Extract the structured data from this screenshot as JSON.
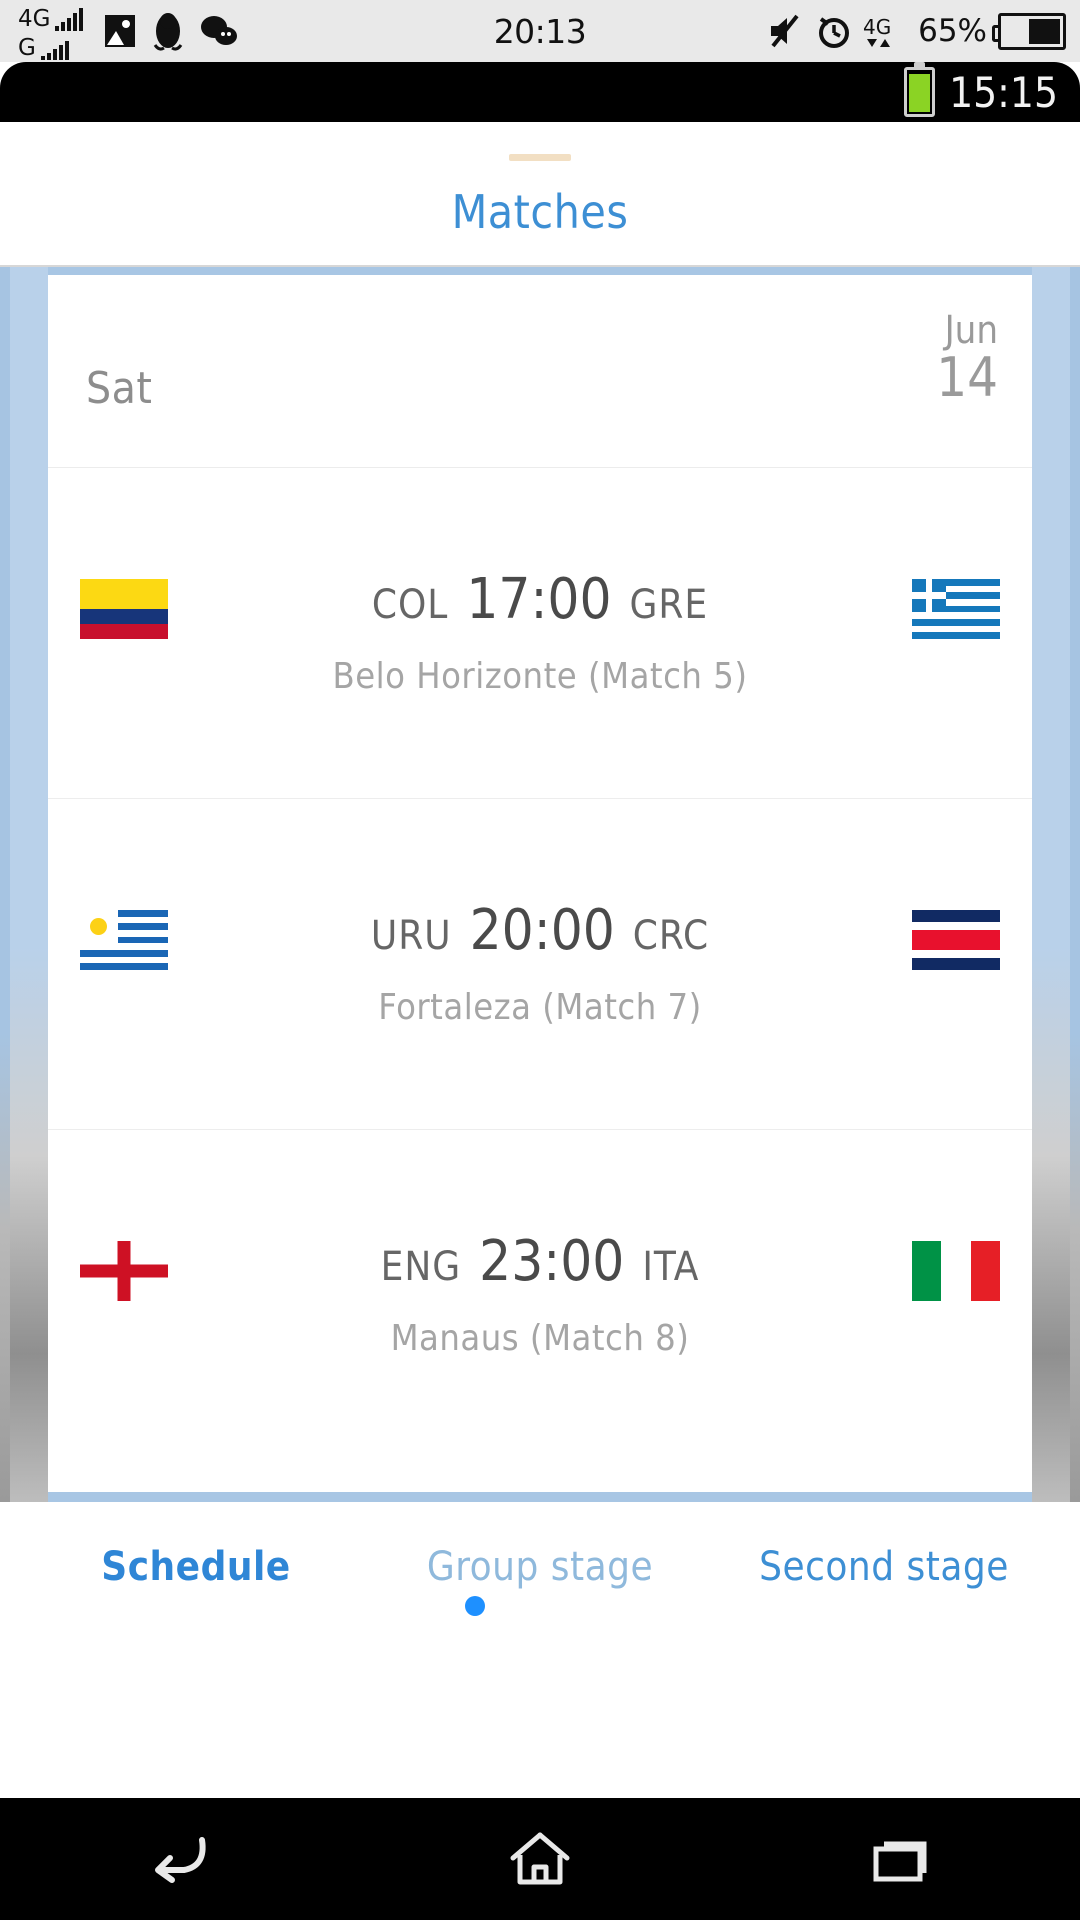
{
  "host_status_bar": {
    "network_primary": "4G",
    "network_secondary": "G",
    "clock": "20:13",
    "battery_percent": "65%",
    "icons": [
      "photo-icon",
      "penguin-icon",
      "wechat-icon",
      "mute-icon",
      "alarm-icon",
      "data-transfer-icon",
      "battery-icon"
    ]
  },
  "device_status_bar": {
    "clock": "15:15",
    "battery_icon": "battery-icon"
  },
  "app": {
    "title": "Matches",
    "accent_color": "#3d8fd4",
    "frame_color": "#a8c6e4"
  },
  "day_header": {
    "weekday": "Sat",
    "month": "Jun",
    "day": "14"
  },
  "matches": [
    {
      "home_code": "COL",
      "away_code": "GRE",
      "time": "17:00",
      "venue": "Belo Horizonte (Match  5)",
      "home_flag": "colombia-flag",
      "away_flag": "greece-flag"
    },
    {
      "home_code": "URU",
      "away_code": "CRC",
      "time": "20:00",
      "venue": "Fortaleza (Match  7)",
      "home_flag": "uruguay-flag",
      "away_flag": "costa-rica-flag"
    },
    {
      "home_code": "ENG",
      "away_code": "ITA",
      "time": "23:00",
      "venue": "Manaus (Match  8)",
      "home_flag": "england-flag",
      "away_flag": "italy-flag"
    }
  ],
  "tabs": [
    {
      "label": "Schedule",
      "state": "active"
    },
    {
      "label": "Group stage",
      "state": "dim"
    },
    {
      "label": "Second stage",
      "state": "normal"
    }
  ],
  "page_indicator": {
    "dot_color": "#1e90ff"
  },
  "nav_bar": {
    "back_label": "back-icon",
    "home_label": "home-icon",
    "recents_label": "recents-icon"
  }
}
